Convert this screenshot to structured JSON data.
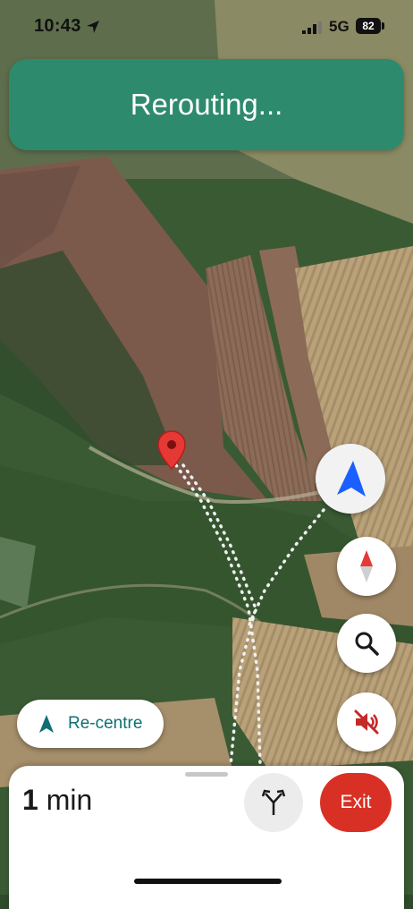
{
  "status_bar": {
    "time": "10:43",
    "network": "5G",
    "battery": "82"
  },
  "banner": {
    "text": "Rerouting..."
  },
  "map": {
    "icons": {
      "destination": "red-map-pin-icon",
      "heading": "blue-navigation-arrow-icon"
    }
  },
  "controls": {
    "compass_icon": "compass-icon",
    "search_icon": "search-icon",
    "mute_icon": "volume-off-icon"
  },
  "recentre": {
    "label": "Re-centre"
  },
  "trip": {
    "eta_value": "1",
    "eta_unit": "min",
    "routes_icon": "alternate-routes-icon",
    "exit_label": "Exit"
  },
  "colors": {
    "banner": "#2e8a6c",
    "exit": "#d93025",
    "recentre_text": "#0f6f73",
    "heading_arrow": "#1a5fff"
  }
}
